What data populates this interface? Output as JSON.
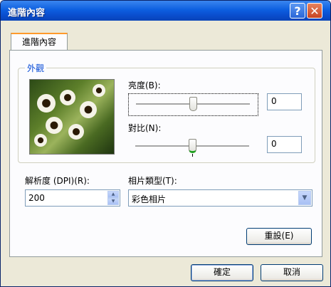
{
  "window": {
    "title": "進階內容",
    "help_glyph": "?",
    "close_glyph": "✕"
  },
  "tab": {
    "label": "進階內容"
  },
  "appearance": {
    "legend": "外觀",
    "brightness": {
      "label": "亮度(B):",
      "value": "0",
      "level_percent": 50
    },
    "contrast": {
      "label": "對比(N):",
      "value": "0",
      "level_percent": 50
    }
  },
  "resolution": {
    "label": "解析度 (DPI)(R):",
    "value": "200",
    "spin_up": "▲",
    "spin_down": "▼"
  },
  "picture_type": {
    "label": "相片類型(T):",
    "value": "彩色相片",
    "dropdown_glyph": "▼"
  },
  "buttons": {
    "reset": "重設(E)",
    "ok": "確定",
    "cancel": "取消"
  }
}
